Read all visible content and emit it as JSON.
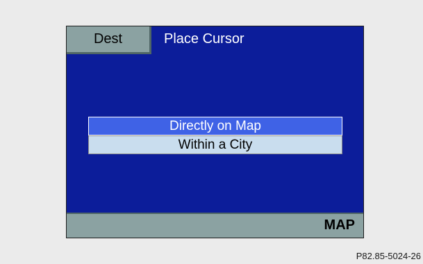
{
  "header": {
    "dest_tab_label": "Dest",
    "title": "Place Cursor"
  },
  "menu": {
    "items": [
      {
        "label": "Directly on Map",
        "selected": true
      },
      {
        "label": "Within a City",
        "selected": false
      }
    ]
  },
  "footer": {
    "softkey_label": "MAP"
  },
  "figure_caption": "P82.85-5024-26",
  "colors": {
    "screen_background": "#0c1d9a",
    "bar_gray_teal": "#8ba2a2",
    "selected_item": "#3f62e6",
    "unselected_item": "#c9ddee",
    "page_background": "#ebebeb"
  }
}
